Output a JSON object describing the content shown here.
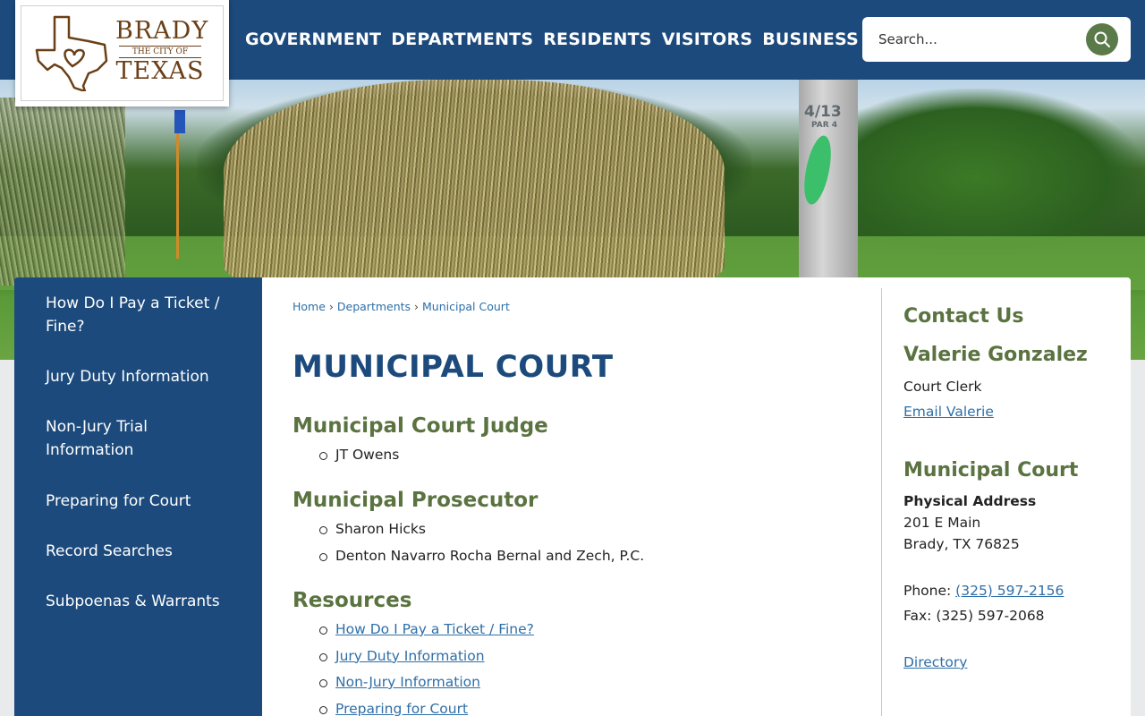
{
  "logo": {
    "line1": "BRADY",
    "line2": "THE CITY OF",
    "line3": "TEXAS"
  },
  "nav": [
    "GOVERNMENT",
    "DEPARTMENTS",
    "RESIDENTS",
    "VISITORS",
    "BUSINESS"
  ],
  "search": {
    "placeholder": "Search..."
  },
  "hero": {
    "post_number": "4/13",
    "post_par": "PAR 4"
  },
  "sidebar": {
    "items": [
      "How Do I Pay a Ticket / Fine?",
      "Jury Duty Information",
      "Non-Jury Trial Information",
      "Preparing for Court",
      "Record Searches",
      "Subpoenas & Warrants"
    ]
  },
  "breadcrumb": {
    "home": "Home",
    "sep1": "›",
    "departments": "Departments",
    "sep2": "›",
    "current": "Municipal Court"
  },
  "page_title": "MUNICIPAL COURT",
  "sections": {
    "judge": {
      "heading": "Municipal Court Judge",
      "items": [
        "JT Owens"
      ]
    },
    "prosecutor": {
      "heading": "Municipal Prosecutor",
      "items": [
        "Sharon Hicks",
        "Denton Navarro Rocha Bernal and Zech, P.C."
      ]
    },
    "resources": {
      "heading": "Resources",
      "items": [
        "How Do I Pay a Ticket / Fine?",
        "Jury Duty Information",
        "Non-Jury Information",
        "Preparing for Court"
      ]
    }
  },
  "contact": {
    "heading": "Contact Us",
    "person_name": "Valerie Gonzalez",
    "person_title": "Court Clerk",
    "email_link": "Email Valerie",
    "dept_name": "Municipal Court",
    "address_label": "Physical Address",
    "address_line1": "201 E Main",
    "address_line2": "Brady, TX 76825",
    "phone_label": "Phone: ",
    "phone": "(325) 597-2156",
    "fax": "Fax: (325) 597-2068",
    "directory_link": "Directory"
  },
  "colors": {
    "navy": "#1c4a7c",
    "green_heading": "#5a7340",
    "link": "#2e6fa8",
    "logo_brown": "#6b3f16"
  }
}
